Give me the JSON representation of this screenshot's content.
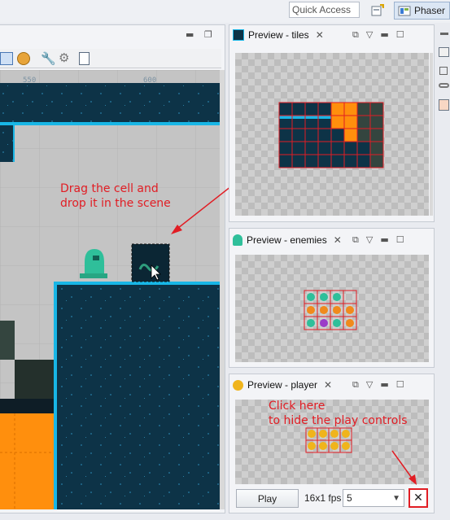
{
  "toolbar": {
    "quick_access_placeholder": "Quick Access",
    "perspective_label": "Phaser"
  },
  "scene": {
    "ruler_ticks": [
      "550",
      "600"
    ],
    "annotation": [
      "Drag the cell and",
      "drop it in the scene"
    ]
  },
  "previews": [
    {
      "title": "Preview - tiles"
    },
    {
      "title": "Preview - enemies"
    },
    {
      "title": "Preview - player"
    }
  ],
  "play_controls": {
    "annotation": [
      "Click here",
      "to hide the play controls"
    ],
    "play_label": "Play",
    "fps_label": "16x1 fps",
    "fps_value": "5",
    "close_label": "✕"
  },
  "colors": {
    "annotation": "#e11d24",
    "grid_red": "#e11d24",
    "water_dark": "#0b2a3a",
    "orange": "#ff8c00"
  }
}
